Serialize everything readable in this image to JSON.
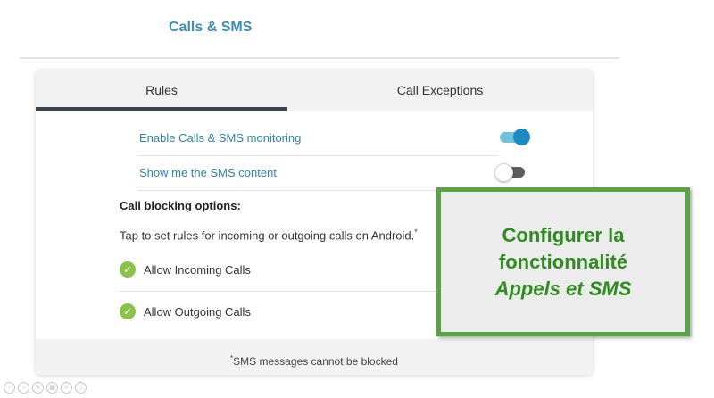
{
  "header": {
    "title": "Calls & SMS"
  },
  "tabs": [
    {
      "label": "Rules",
      "active": true
    },
    {
      "label": "Call Exceptions",
      "active": false
    }
  ],
  "settings": [
    {
      "label": "Enable Calls & SMS monitoring",
      "enabled": true
    },
    {
      "label": "Show me the SMS content",
      "enabled": false
    }
  ],
  "call_blocking": {
    "heading": "Call blocking options:",
    "description": "Tap to set rules for incoming or outgoing calls on Android.",
    "description_mark": "*",
    "options": [
      {
        "label": "Allow Incoming Calls",
        "checked": true
      },
      {
        "label": "Allow Outgoing Calls",
        "checked": true
      }
    ]
  },
  "footer": {
    "mark": "*",
    "note": "SMS messages cannot be blocked"
  },
  "overlay": {
    "line1": "Configurer la",
    "line2": "fonctionnalité",
    "line3": "Appels et SMS"
  },
  "controls": [
    {
      "icon": "previous-icon",
      "glyph": "‹"
    },
    {
      "icon": "next-icon",
      "glyph": "›"
    },
    {
      "icon": "pen-icon",
      "glyph": "✎"
    },
    {
      "icon": "slides-icon",
      "glyph": "▦"
    },
    {
      "icon": "zoom-icon",
      "glyph": "⌕"
    },
    {
      "icon": "more-icon",
      "glyph": "…"
    }
  ],
  "colors": {
    "accent": "#3a8fb5",
    "toggle_on": "#1c8bc4",
    "check": "#8bc34a",
    "overlay_border": "#59a245",
    "overlay_text": "#2f8c1f"
  }
}
